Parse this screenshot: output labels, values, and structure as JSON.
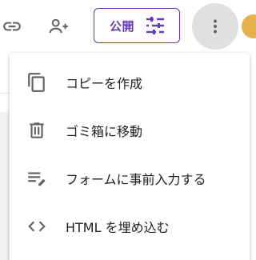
{
  "toolbar": {
    "link_icon": "link-icon",
    "add_person_icon": "person-add-icon",
    "publish_label": "公開",
    "publish_icon": "tune-icon",
    "more_icon": "more-vert-icon",
    "accent_color": "#673ab7"
  },
  "menu": {
    "items": [
      {
        "label": "コピーを作成",
        "icon": "copy-icon"
      },
      {
        "label": "ゴミ箱に移動",
        "icon": "trash-icon"
      },
      {
        "label": "フォームに事前入力する",
        "icon": "prefill-icon"
      },
      {
        "label": "HTML を埋め込む",
        "icon": "code-icon"
      }
    ]
  }
}
